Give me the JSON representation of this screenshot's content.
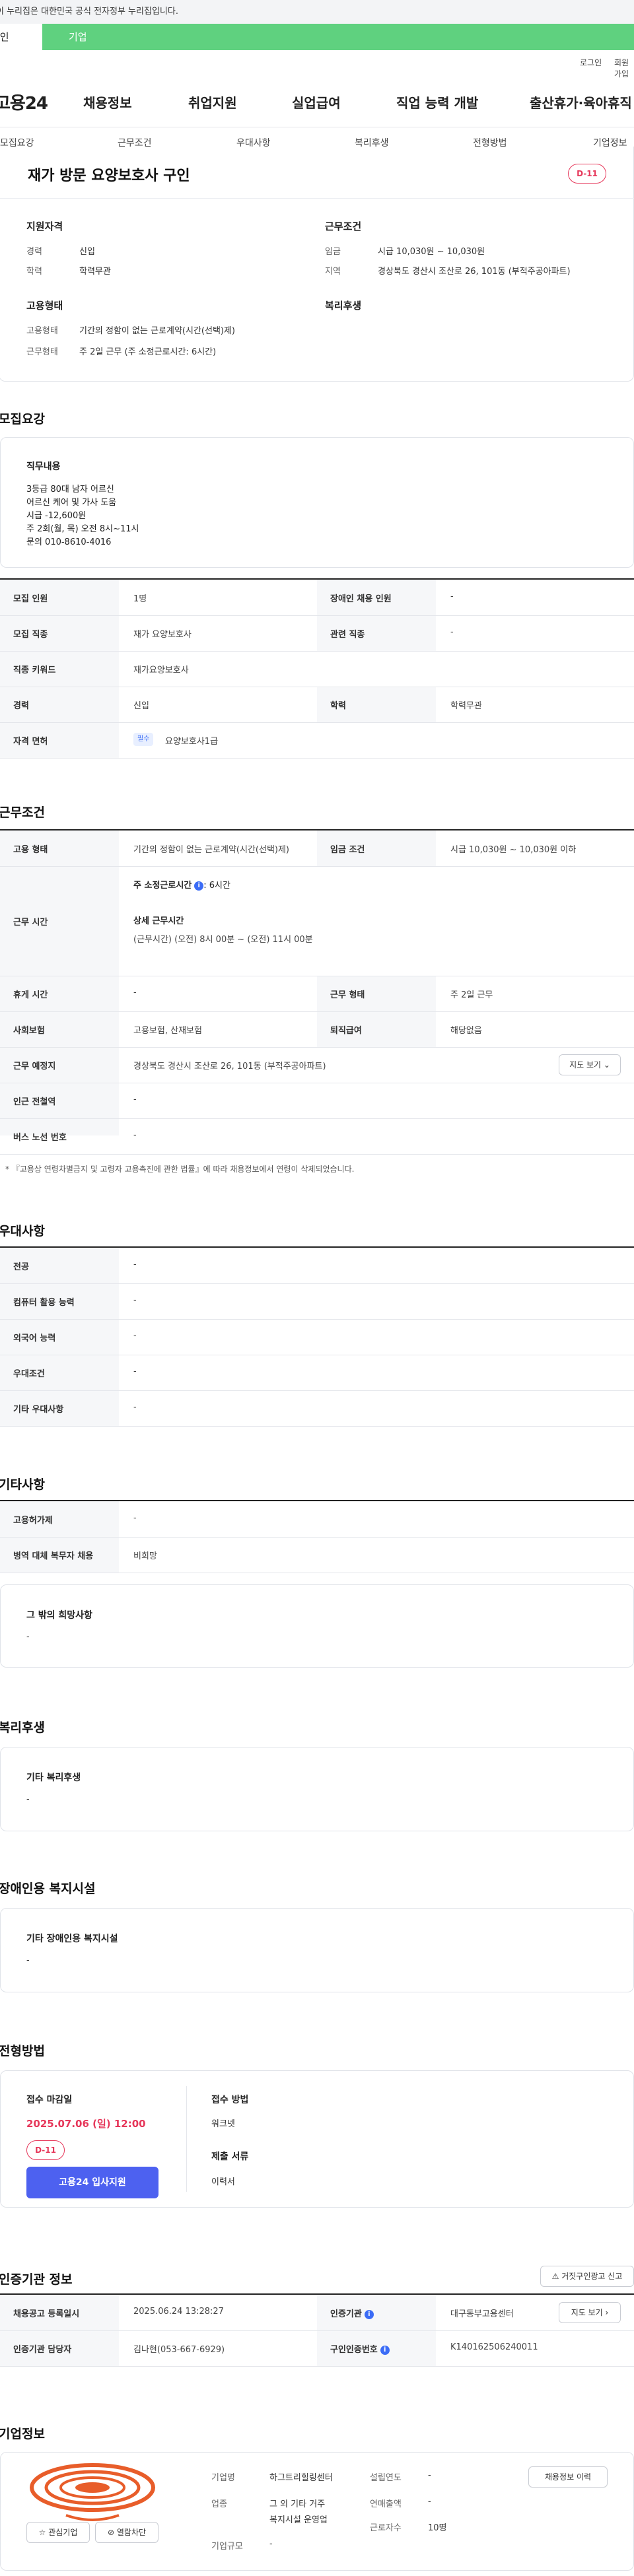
{
  "gov_banner": "이 누리집은 대한민국 공식 전자정부 누리집입니다.",
  "tabs": {
    "person": "개인",
    "business": "기업"
  },
  "util": {
    "login": "로그인",
    "join": "회원가입"
  },
  "logo": "고용24",
  "gnb": [
    "채용정보",
    "취업지원",
    "실업급여",
    "직업 능력 개발",
    "출산휴가·육아휴직"
  ],
  "subnav": [
    "모집요강",
    "근무조건",
    "우대사항",
    "복리후생",
    "전형방법",
    "기업정보"
  ],
  "summary": {
    "title": "재가 방문 요양보호사 구인",
    "dday": "D-11",
    "qualifications_label": "지원자격",
    "career_k": "경력",
    "career_v": "신입",
    "edu_k": "학력",
    "edu_v": "학력무관",
    "conditions_label": "근무조건",
    "wage_k": "임금",
    "wage_v": "시급 10,030원 ~ 10,030원",
    "region_k": "지역",
    "region_v": "경상북도 경산시 조산로 26, 101동 (부적주공아파트)",
    "emp_label": "고용형태",
    "emp_type_k": "고용형태",
    "emp_type_v": "기간의 정함이 없는 근로계약(시간(선택)제)",
    "work_type_k": "근무형태",
    "work_type_v": "주 2일 근무 (주 소정근로시간: 6시간)",
    "welfare_label": "복리후생"
  },
  "recruit": {
    "heading": "모집요강",
    "job_content_label": "직무내용",
    "job_content_lines": [
      "3등급 80대 남자 어르신",
      "어르신 케어 및 가사 도움",
      "시급 -12,600원",
      "주 2회(월, 목) 오전 8시~11시",
      "문의 010-8610-4016"
    ],
    "rows": {
      "count_k": "모집 인원",
      "count_v": "1명",
      "disabled_k": "장애인 채용 인원",
      "disabled_v": "-",
      "job_k": "모집 직종",
      "job_v": "재가 요양보호사",
      "related_k": "관련 직종",
      "related_v": "-",
      "keyword_k": "직종 키워드",
      "keyword_v": "재가요양보호사",
      "career_k": "경력",
      "career_v": "신입",
      "edu_k": "학력",
      "edu_v": "학력무관",
      "license_k": "자격 면허",
      "license_badge": "필수",
      "license_v": "요양보호사1급"
    }
  },
  "conditions": {
    "heading": "근무조건",
    "emp_k": "고용 형태",
    "emp_v": "기간의 정함이 없는 근로계약(시간(선택)제)",
    "wage_k": "임금 조건",
    "wage_v": "시급 10,030원 ~ 10,030원 이하",
    "hours_k": "근무 시간",
    "hours_weekly_label": "주 소정근로시간",
    "hours_weekly_v": ": 6시간",
    "hours_detail_label": "상세 근무시간",
    "hours_detail_v": "(근무시간) (오전) 8시 00분 ~ (오전) 11시 00분",
    "break_k": "휴게 시간",
    "break_v": "-",
    "worktype_k": "근무 형태",
    "worktype_v": "주 2일 근무",
    "insurance_k": "사회보험",
    "insurance_v": "고용보험, 산재보험",
    "severance_k": "퇴직급여",
    "severance_v": "해당없음",
    "location_k": "근무 예정지",
    "location_v": "경상북도 경산시 조산로 26, 101동 (부적주공아파트)",
    "map_btn": "지도 보기",
    "subway_k": "인근 전철역",
    "subway_v": "-",
    "bus_k": "버스 노선 번호",
    "bus_v": "-",
    "footnote": "* 『고용상 연령차별금지 및 고령자 고용촉진에 관한 법률』에 따라 채용정보에서 연령이 삭제되었습니다."
  },
  "preference": {
    "heading": "우대사항",
    "rows": [
      {
        "k": "전공",
        "v": "-"
      },
      {
        "k": "컴퓨터 활용 능력",
        "v": "-"
      },
      {
        "k": "외국어 능력",
        "v": "-"
      },
      {
        "k": "우대조건",
        "v": "-"
      },
      {
        "k": "기타 우대사항",
        "v": "-"
      }
    ]
  },
  "etc": {
    "heading": "기타사항",
    "rows": [
      {
        "k": "고용허가제",
        "v": "-"
      },
      {
        "k": "병역 대체 복무자 채용",
        "v": "비희망"
      }
    ],
    "other_label": "그 밖의 희망사항",
    "other_v": "-"
  },
  "welfare": {
    "heading": "복리후생",
    "label": "기타 복리후생",
    "v": "-"
  },
  "disabled": {
    "heading": "장애인용 복지시설",
    "label": "기타 장애인용 복지시설",
    "v": "-"
  },
  "selection": {
    "heading": "전형방법",
    "deadline_label": "접수 마감일",
    "deadline_v": "2025.07.06 (일) 12:00",
    "dday": "D-11",
    "apply_btn": "고용24 입사지원",
    "method_label": "접수 방법",
    "method_v": "워크넷",
    "docs_label": "제출 서류",
    "docs_v": "이력서"
  },
  "agency": {
    "heading": "인증기관 정보",
    "report_btn": "거짓구인광고 신고",
    "reg_date_k": "채용공고 등록일시",
    "reg_date_v": "2025.06.24 13:28:27",
    "agency_k": "인증기관",
    "agency_v": "대구동부고용센터",
    "map_btn": "지도 보기",
    "staff_k": "인증기관 담당자",
    "staff_v": "김나현(053-667-6929)",
    "number_k": "구인인증번호",
    "number_v": "K140162506240011"
  },
  "company": {
    "heading": "기업정보",
    "name_k": "기업명",
    "name_v": "하그트리힐링센터",
    "founded_k": "설립연도",
    "founded_v": "-",
    "industry_k": "업종",
    "industry_v1": "그 외 기타 거주",
    "industry_v2": "복지시설 운영업",
    "sales_k": "연매출액",
    "sales_v": "-",
    "employees_k": "근로자수",
    "employees_v": "10명",
    "size_k": "기업규모",
    "size_v": "-",
    "history_btn": "채용정보 이력",
    "fav_btn": "관심기업",
    "block_btn": "열람차단",
    "brand_color": "#e85d2a"
  }
}
